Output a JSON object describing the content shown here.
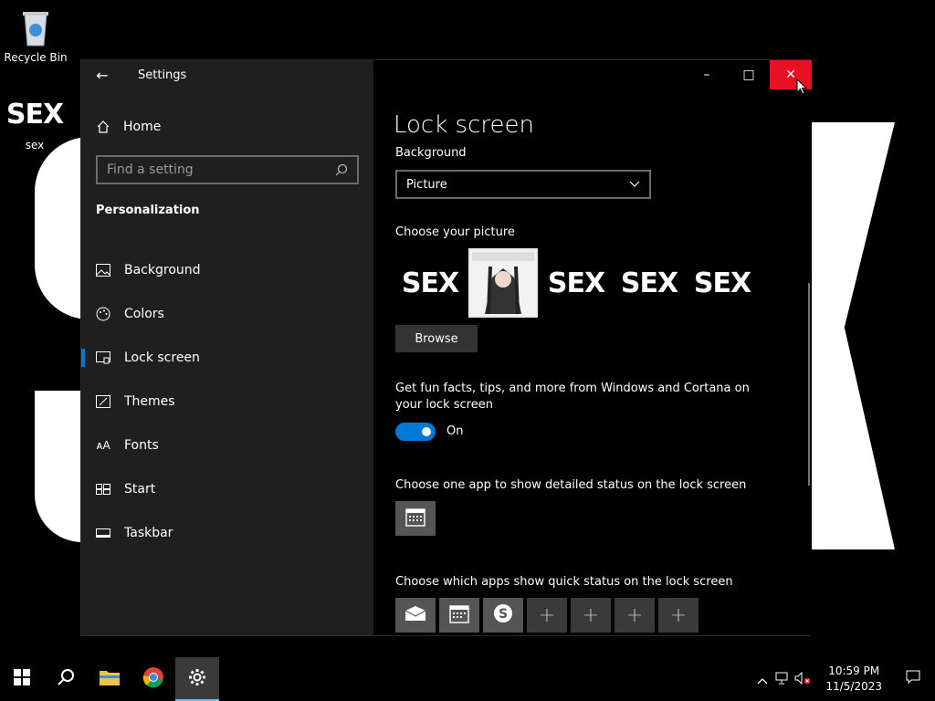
{
  "desktop": {
    "recycle_bin_label": "Recycle Bin",
    "file_icon_label": "sex",
    "file_icon_glyph_text": "SEX"
  },
  "window": {
    "app_title": "Settings",
    "controls": {
      "minimize": "minimize-icon",
      "maximize": "maximize-icon",
      "close": "close-icon"
    }
  },
  "sidebar": {
    "home_label": "Home",
    "search_placeholder": "Find a setting",
    "section_title": "Personalization",
    "items": [
      {
        "label": "Background",
        "icon": "picture-icon"
      },
      {
        "label": "Colors",
        "icon": "palette-icon"
      },
      {
        "label": "Lock screen",
        "icon": "lock-screen-icon",
        "active": true
      },
      {
        "label": "Themes",
        "icon": "themes-icon"
      },
      {
        "label": "Fonts",
        "icon": "fonts-icon"
      },
      {
        "label": "Start",
        "icon": "start-icon"
      },
      {
        "label": "Taskbar",
        "icon": "taskbar-icon"
      }
    ]
  },
  "main": {
    "page_title": "Lock screen",
    "background_label": "Background",
    "background_value": "Picture",
    "choose_picture_label": "Choose your picture",
    "thumbnails": [
      "SEX",
      "",
      "SEX",
      "SEX",
      "SEX"
    ],
    "browse_label": "Browse",
    "fun_facts_label": "Get fun facts, tips, and more from Windows and Cortana on your lock screen",
    "toggle_state_label": "On",
    "toggle_on": true,
    "detailed_status_label": "Choose one app to show detailed status on the lock screen",
    "quick_status_label": "Choose which apps show quick status on the lock screen",
    "quick_status_apps": [
      "mail-icon",
      "calendar-icon",
      "skype-icon",
      "plus-icon",
      "plus-icon",
      "plus-icon",
      "plus-icon"
    ],
    "accent_color": "#0078d7"
  },
  "taskbar": {
    "time": "10:59 PM",
    "date": "11/5/2023",
    "pinned": [
      "start-icon",
      "search-icon",
      "file-explorer-icon",
      "chrome-icon",
      "settings-icon"
    ]
  }
}
